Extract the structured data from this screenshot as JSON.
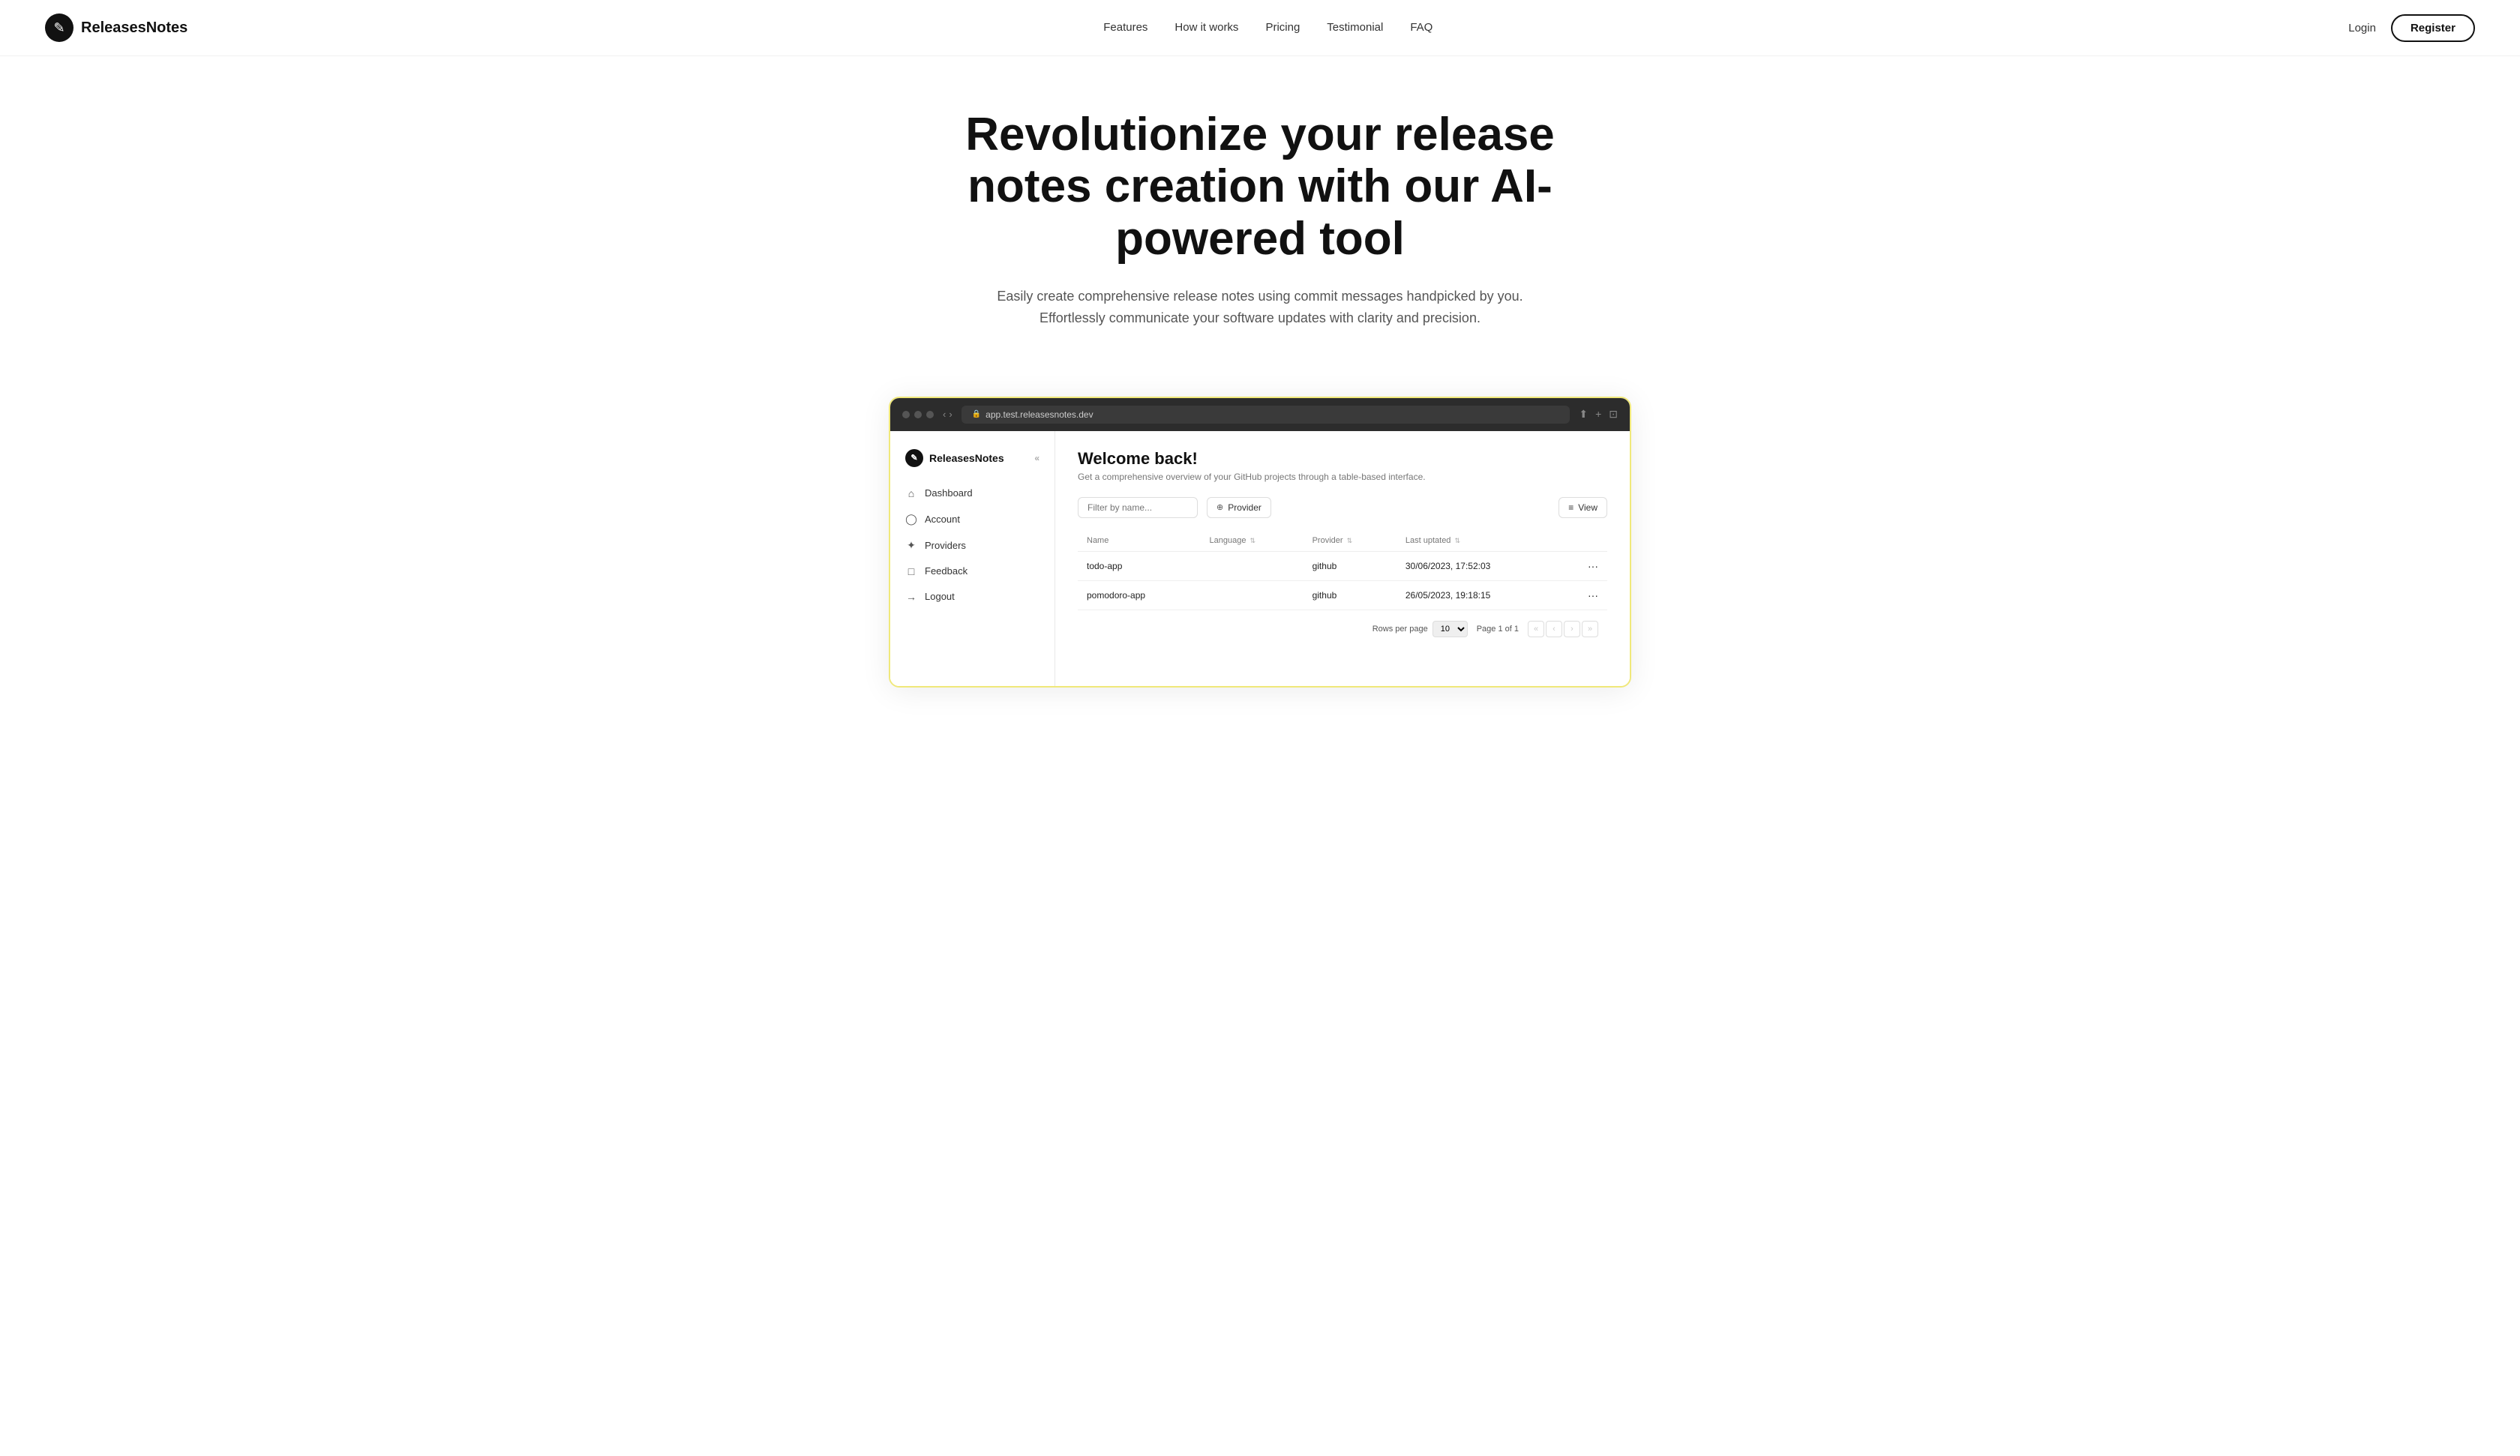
{
  "nav": {
    "logo_text": "ReleasesNotes",
    "logo_icon": "✎",
    "links": [
      {
        "label": "Features",
        "id": "features"
      },
      {
        "label": "How it works",
        "id": "how-it-works"
      },
      {
        "label": "Pricing",
        "id": "pricing"
      },
      {
        "label": "Testimonial",
        "id": "testimonial"
      },
      {
        "label": "FAQ",
        "id": "faq"
      }
    ],
    "login_label": "Login",
    "register_label": "Register"
  },
  "hero": {
    "title": "Revolutionize your release notes creation with our AI-powered tool",
    "subtitle": "Easily create comprehensive release notes using commit messages handpicked by you. Effortlessly communicate your software updates with clarity and precision."
  },
  "browser": {
    "url": "app.test.releasesnotes.dev"
  },
  "sidebar": {
    "logo_text": "ReleasesNotes",
    "logo_icon": "✎",
    "items": [
      {
        "label": "Dashboard",
        "icon": "⌂",
        "id": "dashboard"
      },
      {
        "label": "Account",
        "icon": "○",
        "id": "account"
      },
      {
        "label": "Providers",
        "icon": "✦",
        "id": "providers"
      },
      {
        "label": "Feedback",
        "icon": "□",
        "id": "feedback"
      },
      {
        "label": "Logout",
        "icon": "→",
        "id": "logout"
      }
    ]
  },
  "app": {
    "welcome_title": "Welcome back!",
    "welcome_sub": "Get a comprehensive overview of your GitHub projects through a table-based interface.",
    "filter_placeholder": "Filter by name...",
    "filter_provider_label": "Provider",
    "view_label": "View",
    "table": {
      "columns": [
        {
          "label": "Name",
          "sortable": false
        },
        {
          "label": "Language",
          "sortable": true
        },
        {
          "label": "Provider",
          "sortable": true
        },
        {
          "label": "Last uptated",
          "sortable": true
        },
        {
          "label": "",
          "sortable": false
        }
      ],
      "rows": [
        {
          "name": "todo-app",
          "language": "",
          "provider": "github",
          "last_updated": "30/06/2023, 17:52:03"
        },
        {
          "name": "pomodoro-app",
          "language": "",
          "provider": "github",
          "last_updated": "26/05/2023, 19:18:15"
        }
      ]
    },
    "pagination": {
      "rows_per_page_label": "Rows per page",
      "rows_per_page_value": "10",
      "page_info": "Page 1 of 1"
    }
  }
}
